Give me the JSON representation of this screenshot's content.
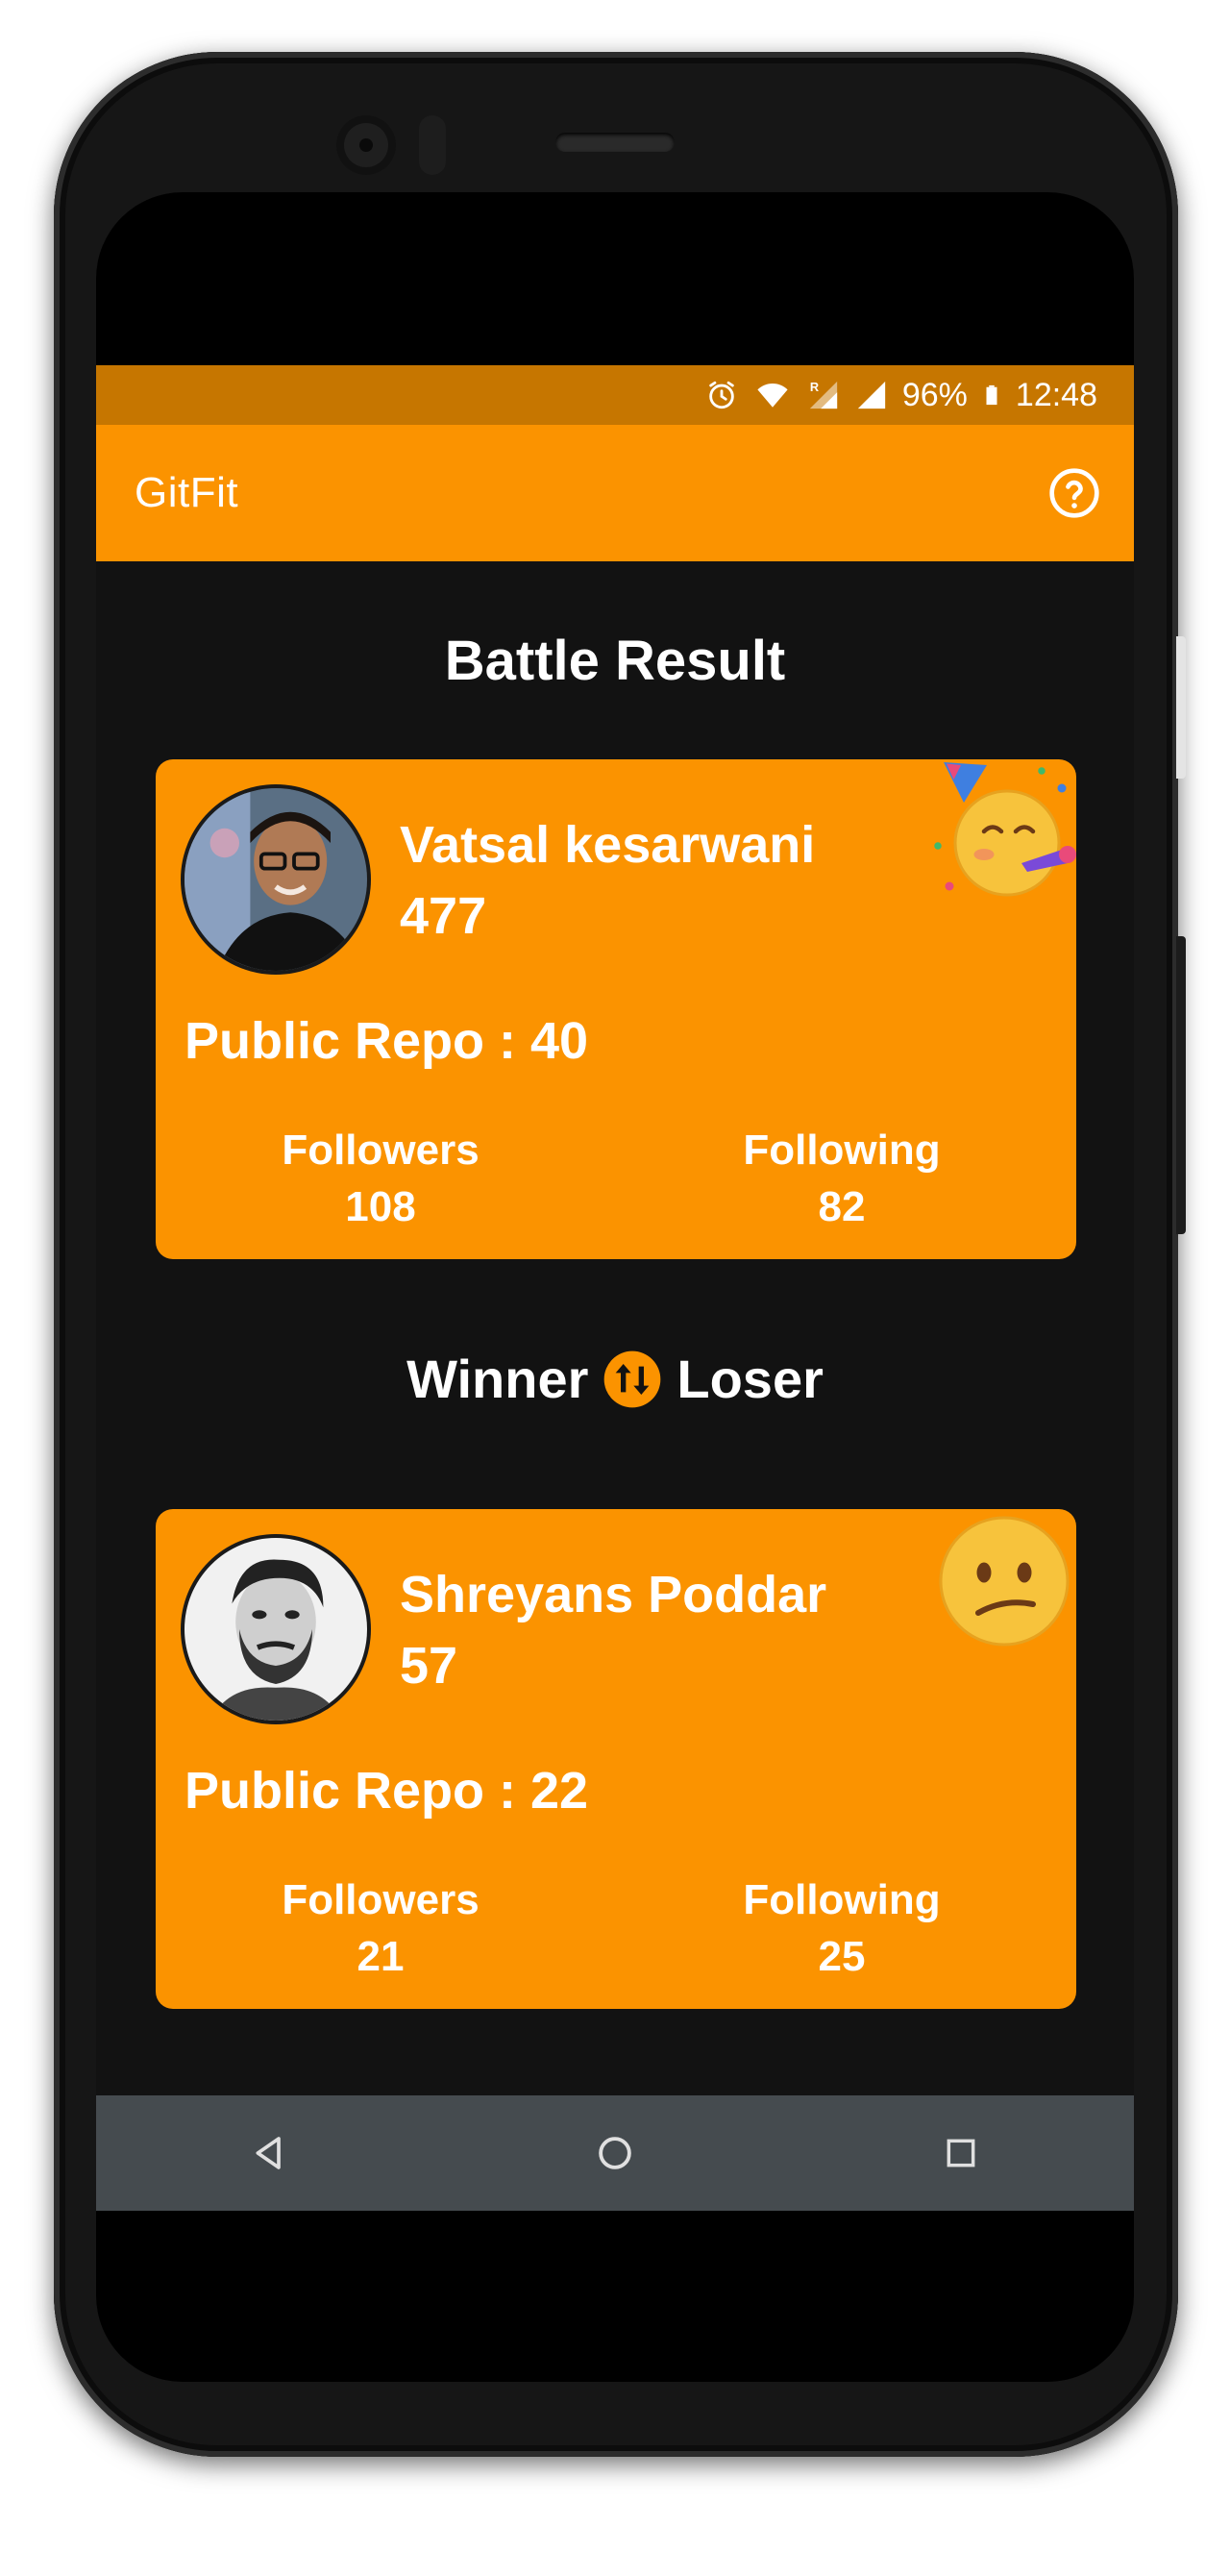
{
  "status_bar": {
    "battery": "96%",
    "time": "12:48",
    "icons": [
      "alarm-icon",
      "wifi-icon",
      "roaming-signal-icon",
      "signal-icon",
      "battery-icon"
    ]
  },
  "app_bar": {
    "title": "GitFit",
    "help_icon": "help-circle-icon"
  },
  "colors": {
    "accent": "#fb9300",
    "status_bar": "#c67600",
    "background": "#121212",
    "nav_bar": "#454b4f"
  },
  "battle": {
    "title": "Battle Result",
    "winner_label": "Winner",
    "loser_label": "Loser",
    "swap_icon": "swap-vertical-icon"
  },
  "winner": {
    "name": "Vatsal kesarwani",
    "score": "477",
    "public_repo": "Public Repo : 40",
    "followers_label": "Followers",
    "followers": "108",
    "following_label": "Following",
    "following": "82",
    "emoji": "partying-face-emoji"
  },
  "loser": {
    "name": "Shreyans Poddar",
    "score": "57",
    "public_repo": "Public Repo : 22",
    "followers_label": "Followers",
    "followers": "21",
    "following_label": "Following",
    "following": "25",
    "emoji": "confused-face-emoji"
  },
  "nav": {
    "back_icon": "back-triangle-icon",
    "home_icon": "home-circle-icon",
    "recents_icon": "recents-square-icon"
  }
}
